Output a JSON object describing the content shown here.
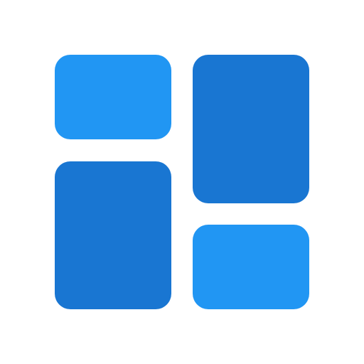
{
  "icon": {
    "name": "dashboard-grid-icon",
    "colors": {
      "background": "#ffffff",
      "light_blue": "#2196f3",
      "dark_blue": "#1976d2"
    },
    "tiles": [
      {
        "name": "tile-top-left",
        "shade": "light_blue"
      },
      {
        "name": "tile-bottom-left",
        "shade": "dark_blue"
      },
      {
        "name": "tile-top-right",
        "shade": "dark_blue"
      },
      {
        "name": "tile-bottom-right",
        "shade": "light_blue"
      }
    ]
  }
}
